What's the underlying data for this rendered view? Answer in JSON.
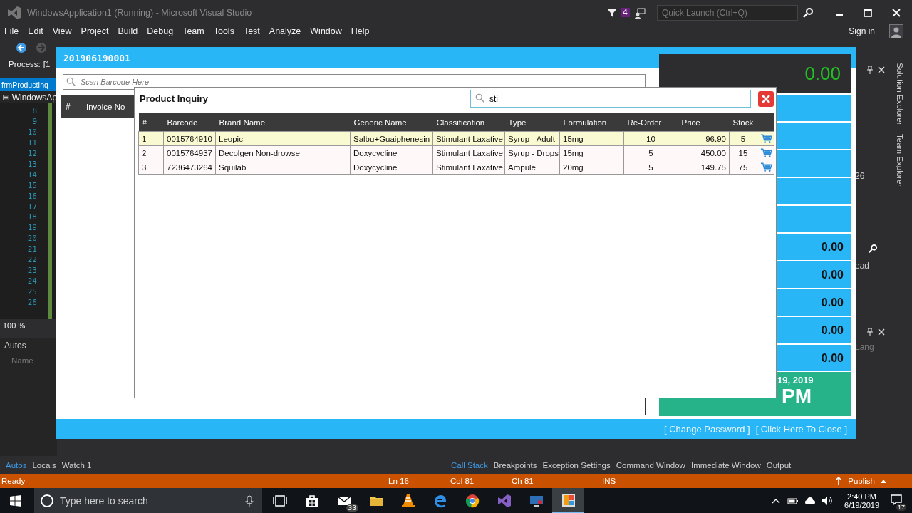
{
  "vs": {
    "title": "WindowsApplication1 (Running) - Microsoft Visual Studio",
    "notification_count": "4",
    "quick_launch": {
      "placeholder": "Quick Launch (Ctrl+Q)"
    },
    "menu": [
      "File",
      "Edit",
      "View",
      "Project",
      "Build",
      "Debug",
      "Team",
      "Tools",
      "Test",
      "Analyze",
      "Window",
      "Help"
    ],
    "sign_in": "Sign in",
    "process_label": "Process:",
    "process_value": "[1",
    "document_tab": "frmProductInq",
    "project_dropdown": "WindowsAp",
    "line_numbers": [
      "8",
      "9",
      "10",
      "11",
      "12",
      "13",
      "14",
      "15",
      "16",
      "17",
      "18",
      "19",
      "20",
      "21",
      "22",
      "23",
      "24",
      "25",
      "26"
    ],
    "zoom": "100 %",
    "autos": {
      "title": "Autos",
      "column": "Name"
    },
    "panel_fragments": [
      "26",
      "ead",
      "Lang"
    ],
    "side_tabs": [
      "Solution Explorer",
      "Team Explorer"
    ],
    "left_tabs": [
      {
        "label": "Autos",
        "selected": true
      },
      {
        "label": "Locals",
        "selected": false
      },
      {
        "label": "Watch 1",
        "selected": false
      }
    ],
    "right_tabs": [
      {
        "label": "Call Stack",
        "selected": true
      },
      {
        "label": "Breakpoints",
        "selected": false
      },
      {
        "label": "Exception Settings",
        "selected": false
      },
      {
        "label": "Command Window",
        "selected": false
      },
      {
        "label": "Immediate Window",
        "selected": false
      },
      {
        "label": "Output",
        "selected": false
      }
    ],
    "status_bar": {
      "state": "Ready",
      "items": [
        "Ln 16",
        "Col 81",
        "Ch 81",
        "INS"
      ],
      "publish": "Publish"
    }
  },
  "pos": {
    "transaction_no": "201906190001",
    "scan": {
      "placeholder": "Scan Barcode Here"
    },
    "invoice_columns": [
      "#",
      "Invoice No"
    ],
    "total": "0.00",
    "amounts": [
      "0.00",
      "0.00",
      "0.00",
      "0.00",
      "0.00"
    ],
    "date": "19, 2019",
    "time": "PM",
    "links": [
      "[ Change Password ]",
      "[ Click Here To Close ]"
    ]
  },
  "dialog": {
    "title": "Product Inquiry",
    "search": {
      "value": "sti"
    },
    "columns": [
      "#",
      "Barcode",
      "Brand Name",
      "Generic Name",
      "Classification",
      "Type",
      "Formulation",
      "Re-Order",
      "Price",
      "Stock"
    ],
    "rows": [
      {
        "selected": true,
        "cells": [
          "1",
          "0015764910",
          "Leopic",
          "Salbu+Guaiphenesin",
          "Stimulant Laxative",
          "Syrup - Adult",
          "15mg",
          "10",
          "96.90",
          "5"
        ]
      },
      {
        "selected": false,
        "cells": [
          "2",
          "0015764937",
          "Decolgen Non-drowse",
          "Doxycycline",
          "Stimulant Laxative",
          "Syrup - Drops",
          "15mg",
          "5",
          "450.00",
          "15"
        ]
      },
      {
        "selected": false,
        "cells": [
          "3",
          "7236473264",
          "Squilab",
          "Doxycycline",
          "Stimulant Laxative",
          "Ampule",
          "20mg",
          "5",
          "149.75",
          "75"
        ]
      }
    ]
  },
  "taskbar": {
    "search_placeholder": "Type here to search",
    "mail_badge": "33",
    "time": "2:40 PM",
    "date": "6/19/2019",
    "notifications": "17"
  }
}
